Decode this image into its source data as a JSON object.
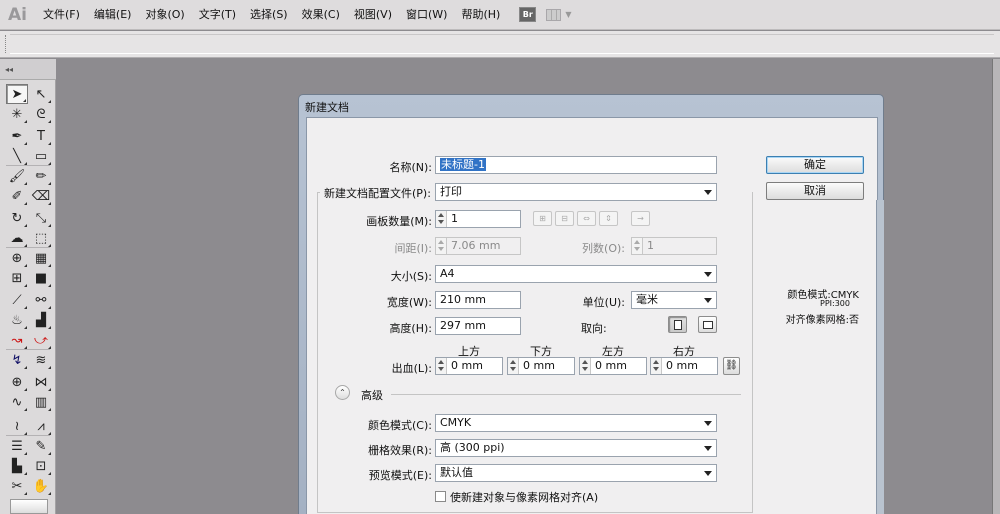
{
  "app": {
    "logo": "Ai"
  },
  "menu": [
    "文件(F)",
    "编辑(E)",
    "对象(O)",
    "文字(T)",
    "选择(S)",
    "效果(C)",
    "视图(V)",
    "窗口(W)",
    "帮助(H)"
  ],
  "bridge_label": "Br",
  "tools_header": "◂◂",
  "tools": [
    {
      "name": "selection-tool",
      "glyph": "➤"
    },
    {
      "name": "direct-selection-tool",
      "glyph": "↖"
    },
    {
      "name": "magic-wand-tool",
      "glyph": "✳"
    },
    {
      "name": "lasso-tool",
      "glyph": "ᘓ"
    },
    {
      "name": "pen-tool",
      "glyph": "✒"
    },
    {
      "name": "type-tool",
      "glyph": "T"
    },
    {
      "name": "line-tool",
      "glyph": "╲"
    },
    {
      "name": "rectangle-tool",
      "glyph": "▭"
    },
    {
      "name": "paintbrush-tool",
      "glyph": "🖌"
    },
    {
      "name": "pencil-tool",
      "glyph": "✏"
    },
    {
      "name": "blob-brush-tool",
      "glyph": "✐"
    },
    {
      "name": "eraser-tool",
      "glyph": "⌫"
    },
    {
      "name": "rotate-tool",
      "glyph": "↻"
    },
    {
      "name": "scale-tool",
      "glyph": "⤡"
    },
    {
      "name": "warp-tool",
      "glyph": "☁"
    },
    {
      "name": "free-transform-tool",
      "glyph": "⬚"
    },
    {
      "name": "shape-builder-tool",
      "glyph": "⊕"
    },
    {
      "name": "perspective-grid-tool",
      "glyph": "▦"
    },
    {
      "name": "mesh-tool",
      "glyph": "⊞"
    },
    {
      "name": "gradient-tool",
      "glyph": "■"
    },
    {
      "name": "eyedropper-tool",
      "glyph": "⟋"
    },
    {
      "name": "blend-tool",
      "glyph": "⚯"
    },
    {
      "name": "symbol-sprayer-tool",
      "glyph": "♨"
    },
    {
      "name": "column-graph-tool",
      "glyph": "▟"
    },
    {
      "name": "width-tool-red",
      "glyph": "↝"
    },
    {
      "name": "curve-tool-red",
      "glyph": "⤻"
    },
    {
      "name": "path-tool-blue",
      "glyph": "↯"
    },
    {
      "name": "wave-tool-green",
      "glyph": "≋"
    },
    {
      "name": "crosshair-tool",
      "glyph": "⊕"
    },
    {
      "name": "envelope-tool",
      "glyph": "⋈"
    },
    {
      "name": "wave-shape-tool",
      "glyph": "∿"
    },
    {
      "name": "grid-tool",
      "glyph": "▥"
    },
    {
      "name": "scribble-tool",
      "glyph": "≀"
    },
    {
      "name": "zigzag-tool",
      "glyph": "⩘"
    },
    {
      "name": "list-tool",
      "glyph": "☰"
    },
    {
      "name": "live-paint-tool",
      "glyph": "✎"
    },
    {
      "name": "chart-tool",
      "glyph": "▙"
    },
    {
      "name": "artboard-tool",
      "glyph": "⊡"
    },
    {
      "name": "slice-tool",
      "glyph": "✂"
    },
    {
      "name": "hand-tool",
      "glyph": "✋"
    },
    {
      "name": "zoom-tool",
      "glyph": "🔍"
    }
  ],
  "dialog": {
    "title": "新建文档",
    "name_label": "名称(N):",
    "name_value": "未标题-1",
    "profile_label": "新建文档配置文件(P):",
    "profile_value": "打印",
    "artboards_label": "画板数量(M):",
    "artboards_value": "1",
    "spacing_label": "间距(I):",
    "spacing_value": "7.06 mm",
    "columns_label": "列数(O):",
    "columns_value": "1",
    "size_label": "大小(S):",
    "size_value": "A4",
    "width_label": "宽度(W):",
    "width_value": "210 mm",
    "units_label": "单位(U):",
    "units_value": "毫米",
    "height_label": "高度(H):",
    "height_value": "297 mm",
    "orientation_label": "取向:",
    "bleed_label": "出血(L):",
    "bleed": {
      "top_label": "上方",
      "top_value": "0 mm",
      "bottom_label": "下方",
      "bottom_value": "0 mm",
      "left_label": "左方",
      "left_value": "0 mm",
      "right_label": "右方",
      "right_value": "0 mm"
    },
    "advanced_label": "高级",
    "color_mode_label": "颜色模式(C):",
    "color_mode_value": "CMYK",
    "raster_label": "栅格效果(R):",
    "raster_value": "高 (300 ppi)",
    "preview_label": "预览模式(E):",
    "preview_value": "默认值",
    "align_pixel_label": "使新建对象与像素网格对齐(A)",
    "ok_label": "确定",
    "cancel_label": "取消",
    "info": {
      "color_mode": "颜色模式:CMYK",
      "ppi": "PPI:300",
      "align": "对齐像素网格:否"
    }
  },
  "colors": {
    "dialog_accent": "#3c7fb1",
    "selection": "#3173c6",
    "tool_red": "#cc1111",
    "tool_blue": "#111166"
  }
}
